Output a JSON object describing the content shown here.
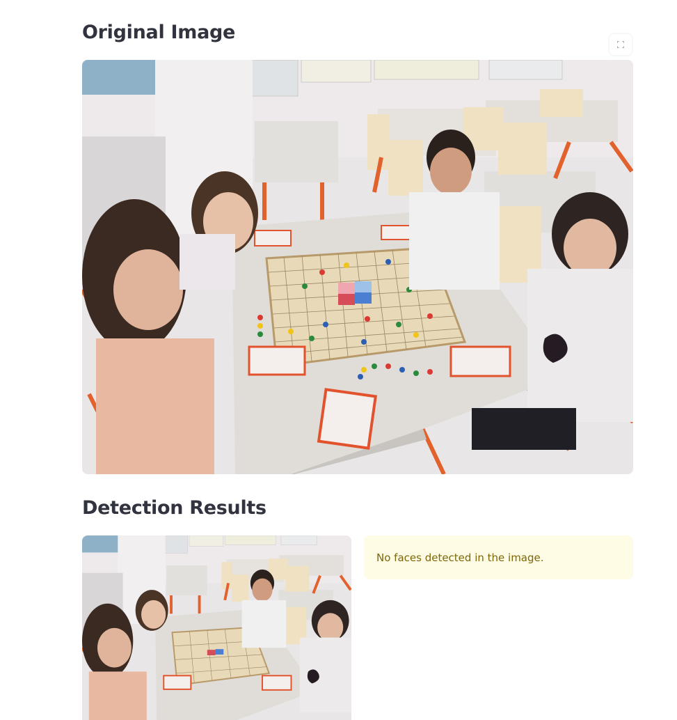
{
  "sections": {
    "original_title": "Original Image",
    "detection_title": "Detection Results"
  },
  "alert": {
    "message": "No faces detected in the image.",
    "background": "#fffce6",
    "text_color": "#7d6608"
  },
  "toolbar": {
    "fullscreen_icon": "fullscreen-expand-icon"
  },
  "images": {
    "original_description_alt": "Children at a classroom table playing a board game",
    "result_description_alt": "Detection result image"
  }
}
